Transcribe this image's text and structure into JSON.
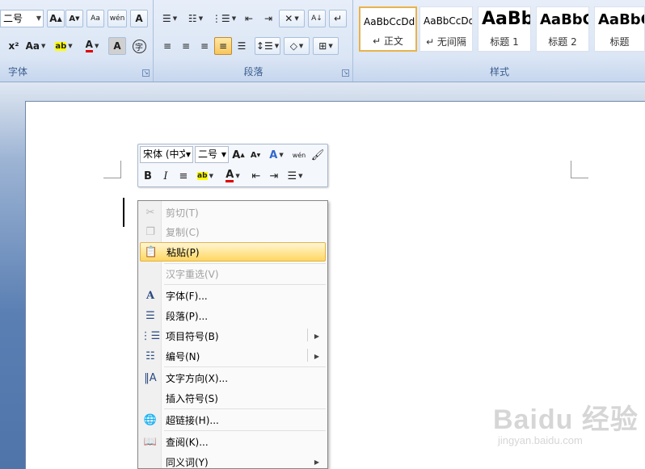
{
  "ribbon": {
    "font_group": {
      "title": "字体",
      "size_value": "二号"
    },
    "paragraph_group": {
      "title": "段落"
    },
    "styles_group": {
      "title": "样式",
      "tiles": [
        {
          "sample": "AaBbCcDd",
          "label": "↵ 正文",
          "selected": true
        },
        {
          "sample": "AaBbCcDd",
          "label": "↵ 无间隔",
          "selected": false
        },
        {
          "sample": "AaBb",
          "label": "标题 1",
          "selected": false
        },
        {
          "sample": "AaBbC",
          "label": "标题 2",
          "selected": false
        },
        {
          "sample": "AaBbC",
          "label": "标题",
          "selected": false
        }
      ]
    }
  },
  "mini_toolbar": {
    "font_name": "宋体 (中文",
    "font_size": "二号"
  },
  "context_menu": {
    "items": [
      {
        "label": "剪切(T)",
        "icon": "scissors-icon",
        "disabled": true
      },
      {
        "label": "复制(C)",
        "icon": "copy-icon",
        "disabled": true
      },
      {
        "label": "粘贴(P)",
        "icon": "paste-icon",
        "disabled": false,
        "highlighted": true
      },
      {
        "label": "汉字重选(V)",
        "icon": "",
        "disabled": true
      },
      {
        "label": "字体(F)...",
        "icon": "font-icon",
        "disabled": false
      },
      {
        "label": "段落(P)...",
        "icon": "paragraph-icon",
        "disabled": false
      },
      {
        "label": "项目符号(B)",
        "icon": "bullets-icon",
        "disabled": false,
        "submenu": true
      },
      {
        "label": "编号(N)",
        "icon": "numbering-icon",
        "disabled": false,
        "submenu": true
      },
      {
        "label": "文字方向(X)...",
        "icon": "text-direction-icon",
        "disabled": false
      },
      {
        "label": "插入符号(S)",
        "icon": "",
        "disabled": false
      },
      {
        "label": "超链接(H)...",
        "icon": "hyperlink-icon",
        "disabled": false
      },
      {
        "label": "查阅(K)...",
        "icon": "lookup-icon",
        "disabled": false
      },
      {
        "label": "同义词(Y)",
        "icon": "",
        "disabled": false,
        "submenu": true
      }
    ]
  },
  "watermark": {
    "logo": "Baidu 经验",
    "url": "jingyan.baidu.com"
  }
}
